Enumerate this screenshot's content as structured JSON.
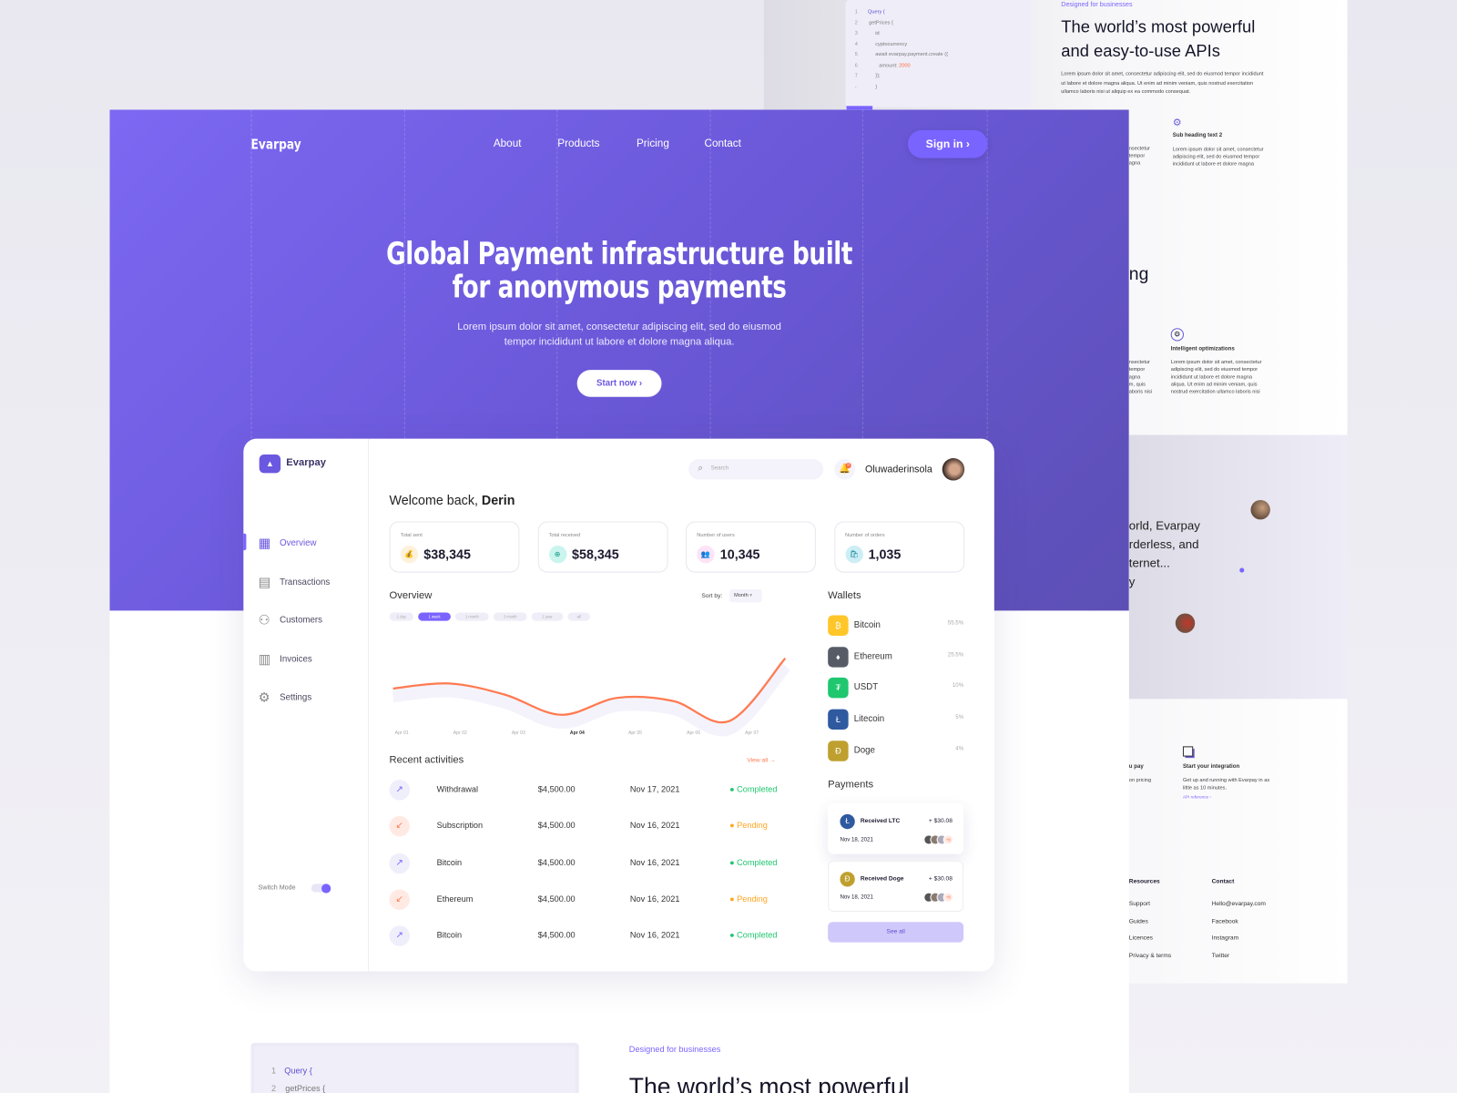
{
  "background_page": {
    "code_lines": [
      {
        "n": "1",
        "t": "Query {"
      },
      {
        "n": "2",
        "t": "getPrices {"
      },
      {
        "n": "3",
        "t": "id"
      },
      {
        "n": "4",
        "t": "cyptocurrency"
      },
      {
        "n": "5",
        "t": "await evarpay.payment.create ({"
      },
      {
        "n": "6",
        "t": "amount: ",
        "v": "2000"
      },
      {
        "n": "7",
        "t": "});"
      },
      {
        "n": "-",
        "t": "}"
      }
    ],
    "eyebrow": "Designed for businesses",
    "heading_line1": "The world’s most powerful",
    "heading_line2": "and easy-to-use APIs",
    "paragraph": "Lorem ipsum dolor sit amet, consectetur adipiscing elit, sed do eiusmod tempor incididunt ut labore et dolore magna aliqua. Ut enim ad minim veniam, quis nostrud exercitation ullamco laboris nisi ut aliquip ex ea commodo consequat.",
    "partial_left_1": "nsectetur\ntempor\nagna",
    "sub2_title": "Sub heading text 2",
    "sub2_text": "Lorem ipsum dolor sit amet, consectetur adipiscing elit, sed do eiusmod tempor incididunt ut labore et dolore magna",
    "partial_heading": "ng",
    "partial_left_2": "nsectetur\ntempor\nagna\nm, quis\naboris nisi",
    "opt_title": "Intelligent optimizations",
    "opt_text": "Lorem ipsum dolor sit amet, consectetur adipiscing elit, sed do eiusmod tempor incididunt ut labore et dolore magna aliqua. Ut enim ad minim veniam, quis nostrud exercitation ullamco laboris nisi",
    "partial_quote": [
      "orld, Evarpay",
      "rderless, and",
      "ternet...",
      "y"
    ],
    "partial_pay_title": "u pay",
    "partial_pay_text": "on pricing",
    "integration_title": "Start your integration",
    "integration_text": "Get up and running with Evarpay in as little as 10 minutes.",
    "integration_link": "API reference  ›",
    "footer": {
      "resources_title": "Resources",
      "resources": [
        "Support",
        "Guides",
        "Licences",
        "Privacy & terms"
      ],
      "contact_title": "Contact",
      "contact": [
        "Hello@evarpay.com",
        "Facebook",
        "Instagram",
        "Twitter"
      ]
    }
  },
  "nav": {
    "logo": "Evarpay",
    "links": [
      "About",
      "Products",
      "Pricing",
      "Contact"
    ],
    "signin": "Sign in ›"
  },
  "hero": {
    "title_line1": "Global Payment infrastructure built",
    "title_line2": "for anonymous payments",
    "subtitle_line1": "Lorem ipsum dolor sit amet, consectetur adipiscing elit, sed do eiusmod",
    "subtitle_line2": "tempor incididunt ut labore et dolore magna aliqua.",
    "cta": "Start now  ›"
  },
  "dashboard": {
    "logo": "Evarpay",
    "sidebar": [
      {
        "label": "Overview",
        "icon": "grid-icon",
        "active": true
      },
      {
        "label": "Transactions",
        "icon": "receipt-icon"
      },
      {
        "label": "Customers",
        "icon": "users-icon"
      },
      {
        "label": "Invoices",
        "icon": "document-icon"
      },
      {
        "label": "Settings",
        "icon": "gear-icon"
      }
    ],
    "switch_mode": "Switch Mode",
    "search_placeholder": "Search",
    "notification_count": "0",
    "username": "Oluwaderinsola",
    "welcome": "Welcome back, ",
    "welcome_name": "Derin",
    "stats": [
      {
        "label": "Total sent",
        "value": "$38,345",
        "bg": "#fdf1dc",
        "fg": "#c58a1a"
      },
      {
        "label": "Total received",
        "value": "$58,345",
        "bg": "#c9f5ee",
        "fg": "#1a9a85"
      },
      {
        "label": "Number of users",
        "value": "10,345",
        "bg": "#fde3f6",
        "fg": "#d02aa9"
      },
      {
        "label": "Number of orders",
        "value": "1,035",
        "bg": "#cdeef5",
        "fg": "#1b8aa0"
      }
    ],
    "overview_title": "Overview",
    "sort_label": "Sort by:",
    "sort_value": "Month",
    "ranges": [
      "1 day",
      "1 week",
      "1 month",
      "3 month",
      "1 year",
      "all"
    ],
    "active_range": "1 week",
    "recent_title": "Recent activities",
    "view_all": "View all →",
    "activities": [
      {
        "name": "Withdrawal",
        "amount": "$4,500.00",
        "date": "Nov 17, 2021",
        "status": "Completed",
        "dir": "out"
      },
      {
        "name": "Subscription",
        "amount": "$4,500.00",
        "date": "Nov 16, 2021",
        "status": "Pending",
        "dir": "in"
      },
      {
        "name": "Bitcoin",
        "amount": "$4,500.00",
        "date": "Nov 16, 2021",
        "status": "Completed",
        "dir": "out"
      },
      {
        "name": "Ethereum",
        "amount": "$4,500.00",
        "date": "Nov 16, 2021",
        "status": "Pending",
        "dir": "in"
      },
      {
        "name": "Bitcoin",
        "amount": "$4,500.00",
        "date": "Nov 16, 2021",
        "status": "Completed",
        "dir": "out"
      }
    ],
    "wallets_title": "Wallets",
    "wallets": [
      {
        "name": "Bitcoin",
        "pct": "55.5%",
        "color": "#ffc629",
        "glyph": "₿"
      },
      {
        "name": "Ethereum",
        "pct": "25.5%",
        "color": "#565b66",
        "glyph": "♦"
      },
      {
        "name": "USDT",
        "pct": "10%",
        "color": "#1fc76f",
        "glyph": "₮"
      },
      {
        "name": "Litecoin",
        "pct": "5%",
        "color": "#2f5aa0",
        "glyph": "Ł"
      },
      {
        "name": "Doge",
        "pct": "4%",
        "color": "#bfa02e",
        "glyph": "Ð"
      }
    ],
    "payments_title": "Payments",
    "payments": [
      {
        "title": "Received LTC",
        "amount": "+ $30.08",
        "date": "Nov 18, 2021",
        "color": "#2f5aa0",
        "glyph": "Ł",
        "more": "+8"
      },
      {
        "title": "Received Doge",
        "amount": "+ $30.08",
        "date": "Nov 18, 2021",
        "color": "#bfa02e",
        "glyph": "Ð",
        "more": "+8"
      }
    ],
    "see_all": "See all"
  },
  "bottom": {
    "code_lines": [
      {
        "n": "1",
        "t": "Query {"
      },
      {
        "n": "2",
        "t": "getPrices {"
      }
    ],
    "eyebrow": "Designed for businesses",
    "heading": "The world’s most powerful"
  },
  "colors": {
    "accent": "#7a64ff",
    "chart_line": "#ff7a50",
    "completed": "#1fc76f",
    "pending": "#ffa51f"
  },
  "chart_data": {
    "type": "line",
    "x": [
      "Apr 01",
      "Apr 02",
      "Apr 03",
      "Apr 04",
      "Apr 05",
      "Apr 06",
      "Apr 07",
      ""
    ],
    "values": [
      70,
      78,
      60,
      28,
      55,
      50,
      18,
      118
    ],
    "highlight_label": "Apr 04",
    "ylim": [
      0,
      130
    ],
    "grid": false,
    "title": "",
    "xlabel": "",
    "ylabel": ""
  }
}
